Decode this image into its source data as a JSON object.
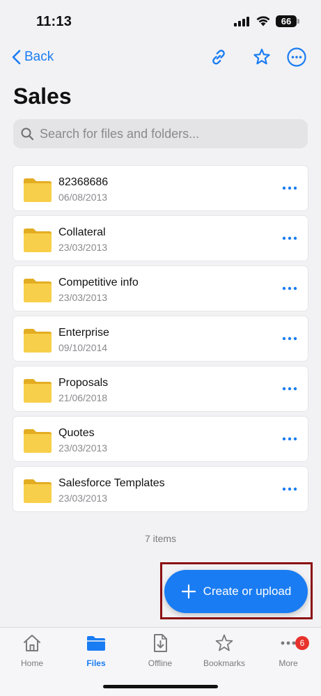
{
  "status_bar": {
    "time": "11:13",
    "battery": "66"
  },
  "nav": {
    "back_label": "Back"
  },
  "page": {
    "title": "Sales"
  },
  "search": {
    "placeholder": "Search for files and folders..."
  },
  "items": [
    {
      "name": "82368686",
      "date": "06/08/2013"
    },
    {
      "name": "Collateral",
      "date": "23/03/2013"
    },
    {
      "name": "Competitive info",
      "date": "23/03/2013"
    },
    {
      "name": "Enterprise",
      "date": "09/10/2014"
    },
    {
      "name": "Proposals",
      "date": "21/06/2018"
    },
    {
      "name": "Quotes",
      "date": "23/03/2013"
    },
    {
      "name": "Salesforce Templates",
      "date": "23/03/2013"
    }
  ],
  "items_count": "7 items",
  "fab": {
    "label": "Create or upload"
  },
  "tabs": [
    {
      "label": "Home",
      "icon": "home-icon"
    },
    {
      "label": "Files",
      "icon": "folder-icon"
    },
    {
      "label": "Offline",
      "icon": "offline-icon"
    },
    {
      "label": "Bookmarks",
      "icon": "star-icon"
    },
    {
      "label": "More",
      "icon": "more-icon",
      "badge": "6"
    }
  ],
  "colors": {
    "accent": "#1a7cf2",
    "folder": "#f5c842",
    "badge": "#e8322c",
    "highlight_frame": "#8b0d12"
  }
}
